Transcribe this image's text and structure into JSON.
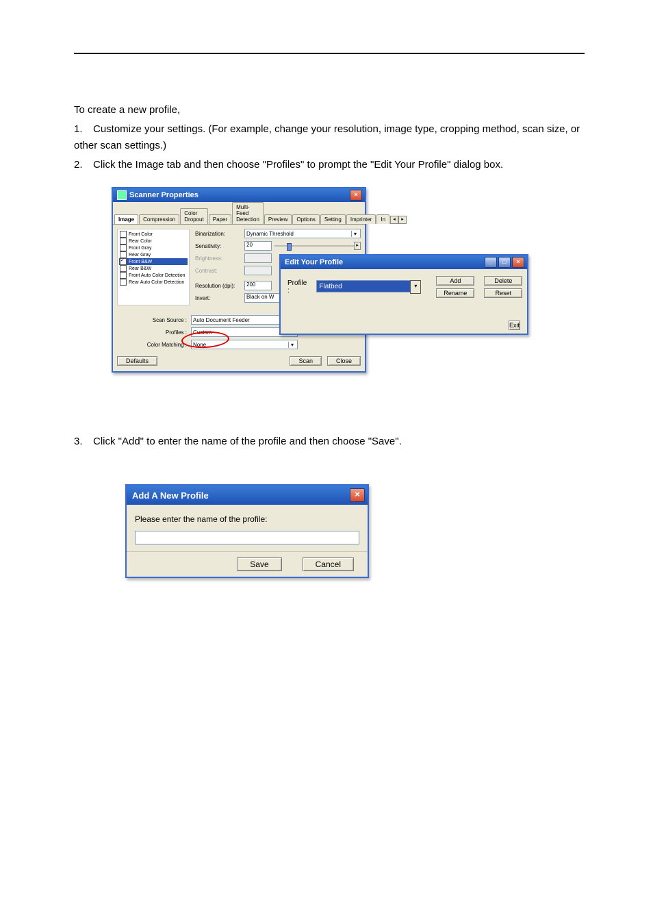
{
  "instructions": {
    "intro": "To create a new profile,",
    "step1_num": "1.",
    "step1": "Customize your settings. (For example, change your resolution, image type, cropping method, scan size, or other scan settings.)",
    "step2_num": "2.",
    "step2": "Click the Image tab and then choose \"Profiles\" to prompt the \"Edit Your Profile\" dialog box.",
    "step3_num": "3.",
    "step3": "Click \"Add\" to enter the name of the profile and then choose \"Save\"."
  },
  "scanner_win": {
    "title": "Scanner Properties",
    "tabs": [
      "Image",
      "Compression",
      "Color Dropout",
      "Paper",
      "Multi-Feed Detection",
      "Preview",
      "Options",
      "Setting",
      "Imprinter",
      "In"
    ],
    "checks": [
      "Front Color",
      "Rear Color",
      "Front Gray",
      "Rear Gray",
      "Front B&W",
      "Rear B&W",
      "Front Auto Color Detection",
      "Rear Auto Color Detection"
    ],
    "labels": {
      "binarization": "Binarization:",
      "sensitivity": "Sensitivity:",
      "brightness": "Brightness:",
      "contrast": "Contrast:",
      "resolution": "Resolution (dpi):",
      "invert": "Invert:",
      "scan_source": "Scan Source :",
      "profiles": "Profiles :",
      "color_matching": "Color Matching :"
    },
    "values": {
      "binarization": "Dynamic Threshold",
      "sensitivity": "20",
      "resolution": "200",
      "invert": "Black on W",
      "scan_source": "Auto Document Feeder",
      "profiles": "Custom",
      "color_matching": "None"
    },
    "buttons": {
      "defaults": "Defaults",
      "scan": "Scan",
      "close": "Close"
    }
  },
  "edit_profile": {
    "title": "Edit Your Profile",
    "label": "Profile :",
    "value": "Flatbed",
    "buttons": {
      "add": "Add",
      "delete": "Delete",
      "rename": "Rename",
      "reset": "Reset",
      "exit": "Exit"
    }
  },
  "add_profile": {
    "title": "Add A New Profile",
    "prompt": "Please enter the name of the profile:",
    "save": "Save",
    "cancel": "Cancel"
  }
}
